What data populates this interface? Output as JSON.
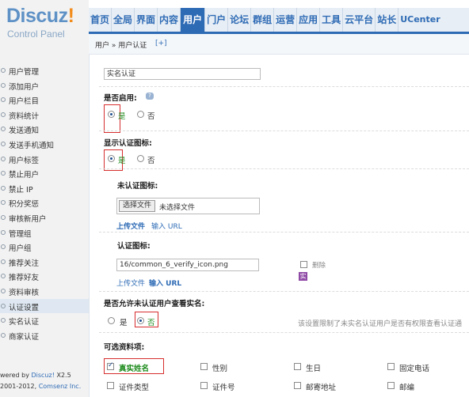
{
  "logo": {
    "brand": "Discuz",
    "bang": "!",
    "subtitle": "Control Panel"
  },
  "nav": [
    "首页",
    "全局",
    "界面",
    "内容",
    "用户",
    "门户",
    "论坛",
    "群组",
    "运营",
    "应用",
    "工具",
    "云平台",
    "站长",
    "UCenter"
  ],
  "nav_active": "用户",
  "breadcrumb": {
    "path": "用户 » 用户认证",
    "plus": "[+]"
  },
  "sidebar": {
    "items": [
      "用户管理",
      "添加用户",
      "用户栏目",
      "资料统计",
      "发送通知",
      "发送手机通知",
      "用户标签",
      "禁止用户",
      "禁止 IP",
      "积分奖惩",
      "审核新用户",
      "管理组",
      "用户组",
      "推荐关注",
      "推荐好友",
      "资料审核",
      "认证设置",
      "实名认证",
      "商家认证"
    ],
    "active": "认证设置"
  },
  "footer": {
    "prefix": "wered by",
    "brand": "Discuz!",
    "version": "X2.5",
    "copyright_prefix": "2001-2012,",
    "company": "Comsenz Inc."
  },
  "form": {
    "name_value": "实名认证",
    "enabled_label": "是否启用:",
    "yes": "是",
    "no": "否",
    "show_icon_label": "显示认证图标:",
    "unverified_icon_label": "未认证图标:",
    "choose_file": "选择文件",
    "no_file": "未选择文件",
    "upload": "上传文件",
    "input_url": "输入 URL",
    "verified_icon_label": "认证图标:",
    "icon_path": "16/common_6_verify_icon.png",
    "delete": "删除",
    "icon_glyph": "实",
    "allow_view_label": "是否允许未认证用户查看实名:",
    "allow_view_hint": "该设置限制了未实名认证用户是否有权限查看认证通",
    "fields_label": "可选资料项:",
    "fields": [
      {
        "label": "真实姓名",
        "checked": true
      },
      {
        "label": "性别",
        "checked": false
      },
      {
        "label": "生日",
        "checked": false
      },
      {
        "label": "固定电话",
        "checked": false
      },
      {
        "label": "证件类型",
        "checked": false
      },
      {
        "label": "证件号",
        "checked": false
      },
      {
        "label": "邮寄地址",
        "checked": false
      },
      {
        "label": "邮编",
        "checked": false
      }
    ]
  }
}
